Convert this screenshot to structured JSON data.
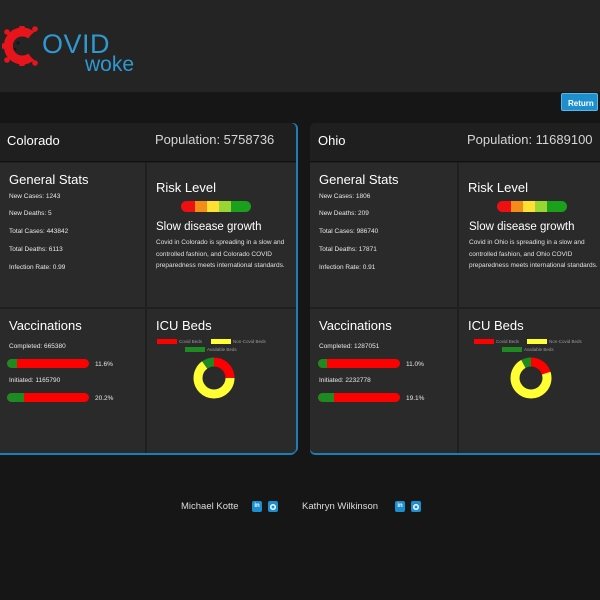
{
  "brand": {
    "c_letter": "C",
    "ovid": "OVID",
    "woke": "woke"
  },
  "header": {
    "return_label": "Return"
  },
  "labels": {
    "general_stats": "General Stats",
    "risk_level": "Risk Level",
    "vaccinations": "Vaccinations",
    "icu_beds": "ICU Beds",
    "new_cases": "New Cases:",
    "new_deaths": "New Deaths:",
    "total_cases": "Total Cases:",
    "total_deaths": "Total Deaths:",
    "infection_rate": "Infection Rate:",
    "completed": "Completed:",
    "initiated": "Initiated:",
    "legend_covid": "Covid Beds",
    "legend_noncovid": "Non-Covid Beds",
    "legend_available": "Available Beds"
  },
  "colors": {
    "accent": "#1d8fce",
    "covid_beds": "#ff0000",
    "noncovid_beds": "#ffff33",
    "available_beds": "#1e8a22"
  },
  "states": [
    {
      "name": "Colorado",
      "population": "Population: 5758736",
      "new_cases": "New Cases: 1243",
      "new_deaths": "New Deaths: 5",
      "total_cases": "Total Cases: 443842",
      "total_deaths": "Total Deaths: 6113",
      "infection_rate": "Infection Rate: 0.99",
      "risk_title": "Slow disease growth",
      "risk_desc": "Covid in Colorado is spreading in a slow and controlled fashion, and Colorado COVID preparedness meets international standards.",
      "completed": "Completed: 665380",
      "completed_pct": "11.6%",
      "completed_frac": 0.116,
      "initiated": "Initiated: 1165790",
      "initiated_pct": "20.2%",
      "initiated_frac": 0.202,
      "icu": {
        "covid": 0.25,
        "noncovid": 0.65,
        "available": 0.1
      }
    },
    {
      "name": "Ohio",
      "population": "Population: 11689100",
      "new_cases": "New Cases: 1806",
      "new_deaths": "New Deaths: 209",
      "total_cases": "Total Cases: 986740",
      "total_deaths": "Total Deaths: 17871",
      "infection_rate": "Infection Rate: 0.91",
      "risk_title": "Slow disease growth",
      "risk_desc": "Covid in Ohio is spreading in a slow and controlled fashion, and Ohio COVID preparedness meets international standards.",
      "completed": "Completed: 1287051",
      "completed_pct": "11.0%",
      "completed_frac": 0.11,
      "initiated": "Initiated: 2232778",
      "initiated_pct": "19.1%",
      "initiated_frac": 0.191,
      "icu": {
        "covid": 0.2,
        "noncovid": 0.72,
        "available": 0.08
      }
    }
  ],
  "footer": {
    "authors": [
      {
        "name": "Michael Kotte",
        "linkedin": "in",
        "github": "gh"
      },
      {
        "name": "Kathryn Wilkinson",
        "linkedin": "in",
        "github": "gh"
      }
    ]
  }
}
